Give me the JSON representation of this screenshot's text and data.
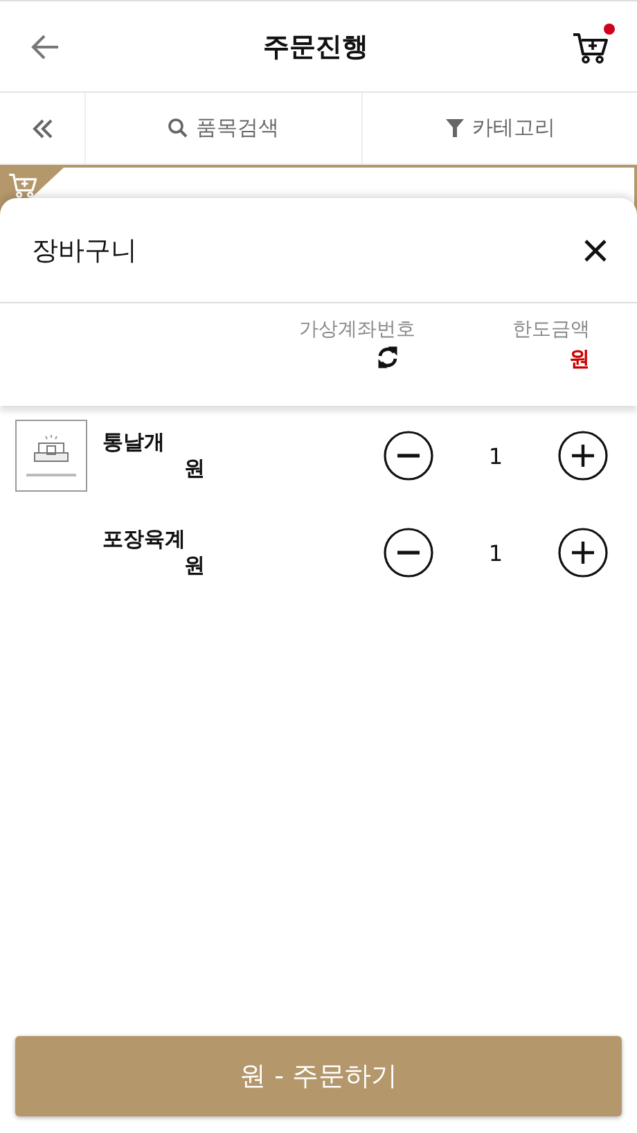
{
  "header": {
    "title": "주문진행",
    "cart_badge": true
  },
  "toolbar": {
    "search": "품목검색",
    "category": "카테고리"
  },
  "sheet": {
    "title": "장바구니",
    "info": [
      {
        "kind": "refresh",
        "label": "가상계좌번호"
      },
      {
        "kind": "amount",
        "label": "한도금액",
        "value": "원"
      }
    ],
    "items": [
      {
        "name": "통날개",
        "price": "원",
        "quantity": "1",
        "has_image": true
      },
      {
        "name": "포장육계",
        "price": "원",
        "quantity": "1",
        "has_image": false
      }
    ]
  },
  "order_button": "원 - 주문하기"
}
